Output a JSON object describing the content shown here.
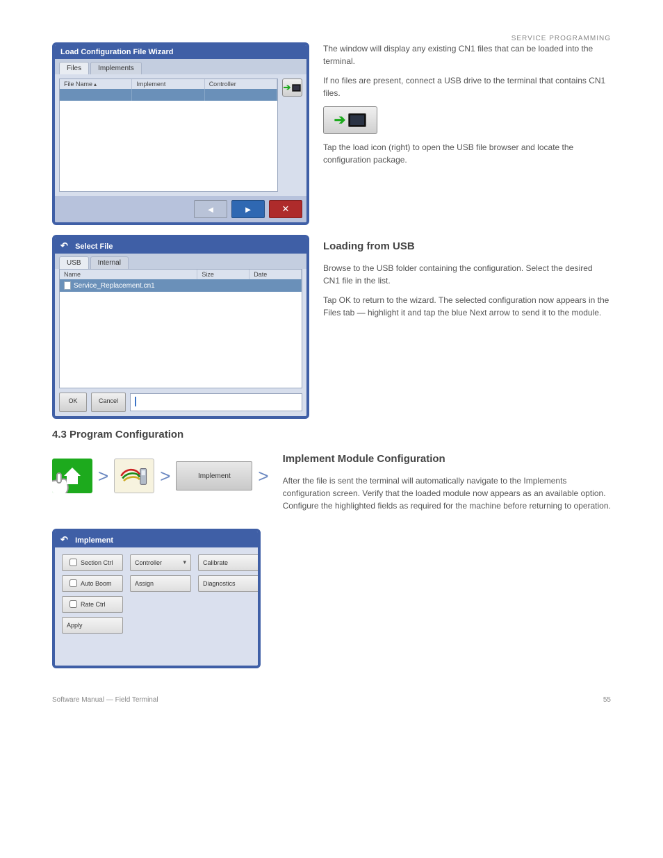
{
  "header_line": "SERVICE PROGRAMMING",
  "section_intro_title": "4.3 Program Configuration",
  "wiz_window": {
    "title": "Load Configuration File Wizard",
    "tabs": [
      "Files",
      "Implements"
    ],
    "columns": [
      "File Name",
      "Implement",
      "Controller"
    ],
    "prev_tip": "Back",
    "next_tip": "Next",
    "close_tip": "Cancel"
  },
  "wiz_prose": [
    "The window will display any existing CN1 files that can be loaded into the terminal.",
    "If no files are present, connect a USB drive to the terminal that contains CN1 files.",
    "Tap the load icon (right) to open the USB file browser and locate the configuration package."
  ],
  "wiz_prose2_title": "Loading from USB",
  "wiz_prose2": [
    "Browse to the USB folder containing the configuration. Select the desired CN1 file in the list.",
    "Tap OK to return to the wizard. The selected configuration now appears in the Files tab — highlight it and tap the blue Next arrow to send it to the module."
  ],
  "usb_window": {
    "title": "Select File",
    "tabs": [
      "USB",
      "Internal"
    ],
    "columns": [
      "Name",
      "Size",
      "Date"
    ],
    "file": "Service_Replacement.cn1",
    "ok_label": "OK",
    "cancel_label": "Cancel",
    "path": " "
  },
  "breadcrumb": {
    "tile3_label": "Implement",
    "arrow": ">"
  },
  "cfg_title": "Implement Module Configuration",
  "cfg_prose": [
    "After the file is sent the terminal will automatically navigate to the Implements configuration screen. Verify that the loaded module now appears as an available option. Configure the highlighted fields as required for the machine before returning to operation."
  ],
  "cfg_window": {
    "title": "Implement",
    "fields": {
      "c1": [
        "Section Ctrl",
        "Auto Boom",
        "Rate Ctrl",
        "Apply"
      ],
      "c2_sel": "Controller",
      "c2_btn": "Assign",
      "c3a": "Calibrate",
      "c3b": "Diagnostics"
    }
  },
  "footer": {
    "left": "Software Manual — Field Terminal",
    "right": "55"
  }
}
